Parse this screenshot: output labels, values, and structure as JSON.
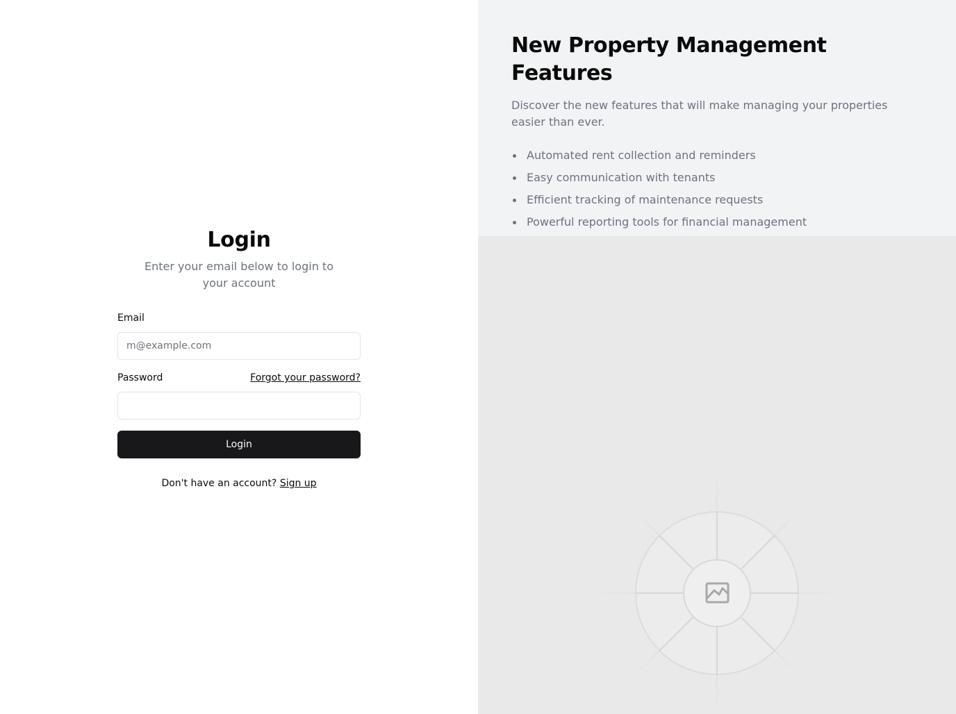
{
  "login": {
    "title": "Login",
    "subtitle": "Enter your email below to login to your account",
    "email_label": "Email",
    "email_placeholder": "m@example.com",
    "email_value": "",
    "password_label": "Password",
    "password_value": "",
    "forgot_link": "Forgot your password?",
    "submit_label": "Login",
    "signup_prompt": "Don't have an account?",
    "signup_link": "Sign up"
  },
  "features": {
    "title": "New Property Management Features",
    "description": "Discover the new features that will make managing your properties easier than ever.",
    "items": [
      "Automated rent collection and reminders",
      "Easy communication with tenants",
      "Efficient tracking of maintenance requests",
      "Powerful reporting tools for financial management"
    ]
  },
  "image_placeholder": {
    "icon": "image-icon"
  },
  "colors": {
    "primary_button": "#18181b",
    "muted_text": "#6b7280",
    "features_background": "#f2f3f4",
    "placeholder_background": "#e9e9e9"
  }
}
